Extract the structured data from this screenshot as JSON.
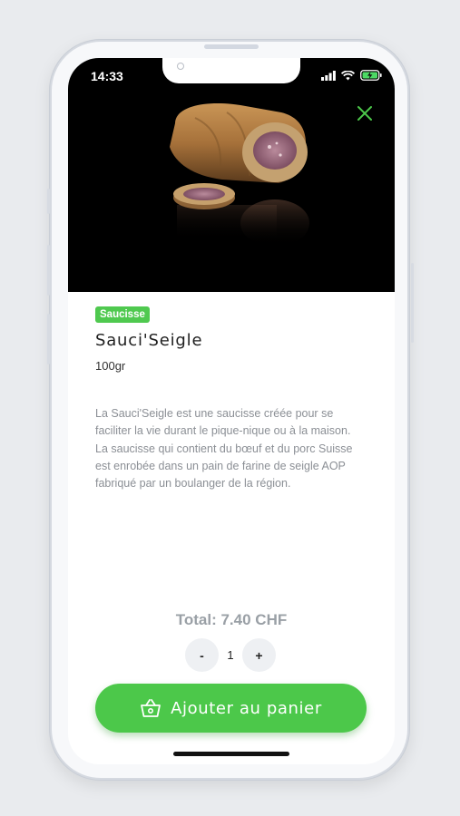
{
  "status_bar": {
    "time": "14:33"
  },
  "product": {
    "category": "Saucisse",
    "name": "Sauci'Seigle",
    "weight": "100gr",
    "description": "La Sauci'Seigle est une saucisse créée pour se faciliter la vie durant le pique-nique ou à la maison. La saucisse qui contient du bœuf et du porc Suisse est enrobée dans un pain de farine de seigle AOP fabriqué par un boulanger de la région."
  },
  "cart": {
    "total": "Total: 7.40 CHF",
    "quantity": "1",
    "minus_label": "-",
    "plus_label": "+",
    "add_button_label": "Ajouter au panier"
  },
  "icons": {
    "close": "close-icon",
    "basket": "basket-icon",
    "signal": "cellular-signal-icon",
    "wifi": "wifi-icon",
    "battery": "battery-charging-icon"
  },
  "colors": {
    "accent": "#4cc84a",
    "category_badge": "#4fc94f",
    "hero_background": "#000000",
    "total_text": "#9aa0a6"
  }
}
